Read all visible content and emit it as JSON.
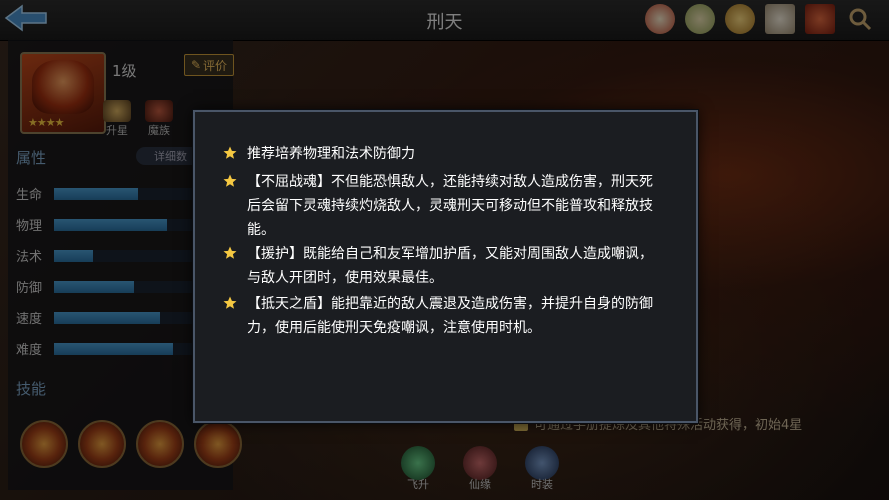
{
  "header": {
    "title": "刑天"
  },
  "hero": {
    "level": "1级",
    "rate_label": "评价",
    "stars": "★★★★"
  },
  "actions": {
    "upgrade": "升星",
    "clan": "魔族"
  },
  "attributes": {
    "title": "属性",
    "detail_label": "详细数",
    "stats": [
      {
        "label": "生命",
        "value": 0.58
      },
      {
        "label": "物理",
        "value": 0.78
      },
      {
        "label": "法术",
        "value": 0.27
      },
      {
        "label": "防御",
        "value": 0.55
      },
      {
        "label": "速度",
        "value": 0.73
      },
      {
        "label": "难度",
        "value": 0.82
      }
    ]
  },
  "skills": {
    "title": "技能"
  },
  "obtain_text": "可通过手册提炼及其他特殊活动获得，初始4星",
  "bottom": {
    "ascend": "飞升",
    "relic": "仙缘",
    "costume": "时装"
  },
  "modal": {
    "tips": [
      "推荐培养物理和法术防御力",
      "【不屈战魂】不但能恐惧敌人，还能持续对敌人造成伤害，刑天死后会留下灵魂持续灼烧敌人，灵魂刑天可移动但不能普攻和释放技能。",
      "【援护】既能给自己和友军增加护盾，又能对周围敌人造成嘲讽，与敌人开团时，使用效果最佳。",
      "【抵天之盾】能把靠近的敌人震退及造成伤害，并提升自身的防御力，使用后能使刑天免疫嘲讽，注意使用时机。"
    ]
  },
  "colors": {
    "star": "#f5c842",
    "stat_fill": "#4a9bd0",
    "modal_border": "#4a5668"
  }
}
